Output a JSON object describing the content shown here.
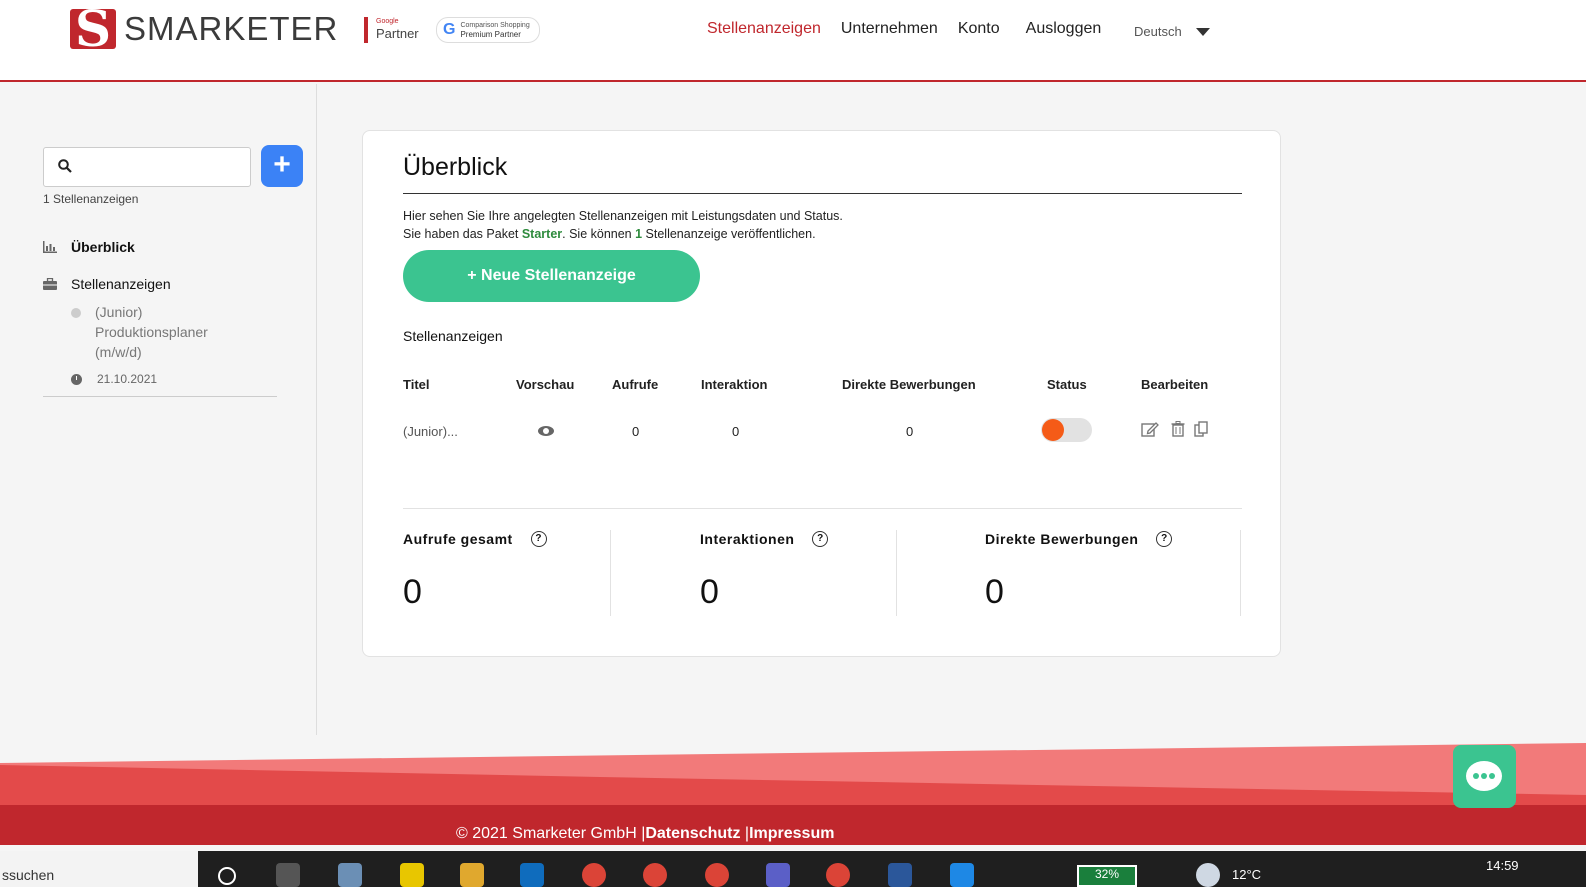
{
  "brand": {
    "name": "SMARKETER",
    "google_partner_small": "Google",
    "google_partner_big": "Partner",
    "premium_line1": "Comparison Shopping",
    "premium_line2": "Premium Partner",
    "accent": "#c0272d"
  },
  "nav": {
    "items": [
      "Stellenanzeigen",
      "Unternehmen",
      "Konto",
      "Ausloggen"
    ],
    "active": "Stellenanzeigen",
    "language": "Deutsch"
  },
  "sidebar": {
    "search_placeholder": "",
    "count": "1 Stellenanzeigen",
    "items": [
      {
        "label": "Überblick",
        "icon": "chart-icon"
      },
      {
        "label": "Stellenanzeigen",
        "icon": "briefcase-icon"
      }
    ],
    "job": {
      "title": "(Junior) Produktionsplaner (m/w/d)",
      "date": "21.10.2021"
    }
  },
  "overview": {
    "title": "Überblick",
    "desc_line1": "Hier sehen Sie Ihre angelegten Stellenanzeigen mit Leistungsdaten und Status.",
    "desc_line2_a": "Sie haben das Paket ",
    "package": "Starter",
    "desc_line2_b": ". Sie können ",
    "limit": "1",
    "desc_line2_c": " Stellenanzeige veröffentlichen.",
    "new_button": "+ Neue Stellenanzeige",
    "section": "Stellenanzeigen",
    "table": {
      "headers": [
        "Titel",
        "Vorschau",
        "Aufrufe",
        "Interaktion",
        "Direkte Bewerbungen",
        "Status",
        "Bearbeiten"
      ],
      "rows": [
        {
          "title": "(Junior)...",
          "aufrufe": "0",
          "interaktion": "0",
          "bewerbungen": "0"
        }
      ]
    },
    "stats": [
      {
        "label": "Aufrufe gesamt",
        "value": "0"
      },
      {
        "label": "Interaktionen",
        "value": "0"
      },
      {
        "label": "Direkte Bewerbungen",
        "value": "0"
      }
    ]
  },
  "footer": {
    "copyright": "© 2021 Smarketer GmbH |",
    "privacy": "Datenschutz",
    "sep": " |",
    "imprint": "Impressum"
  },
  "taskbar": {
    "search_text": "ssuchen",
    "battery": "32%",
    "temperature": "12°C",
    "time": "14:59"
  }
}
